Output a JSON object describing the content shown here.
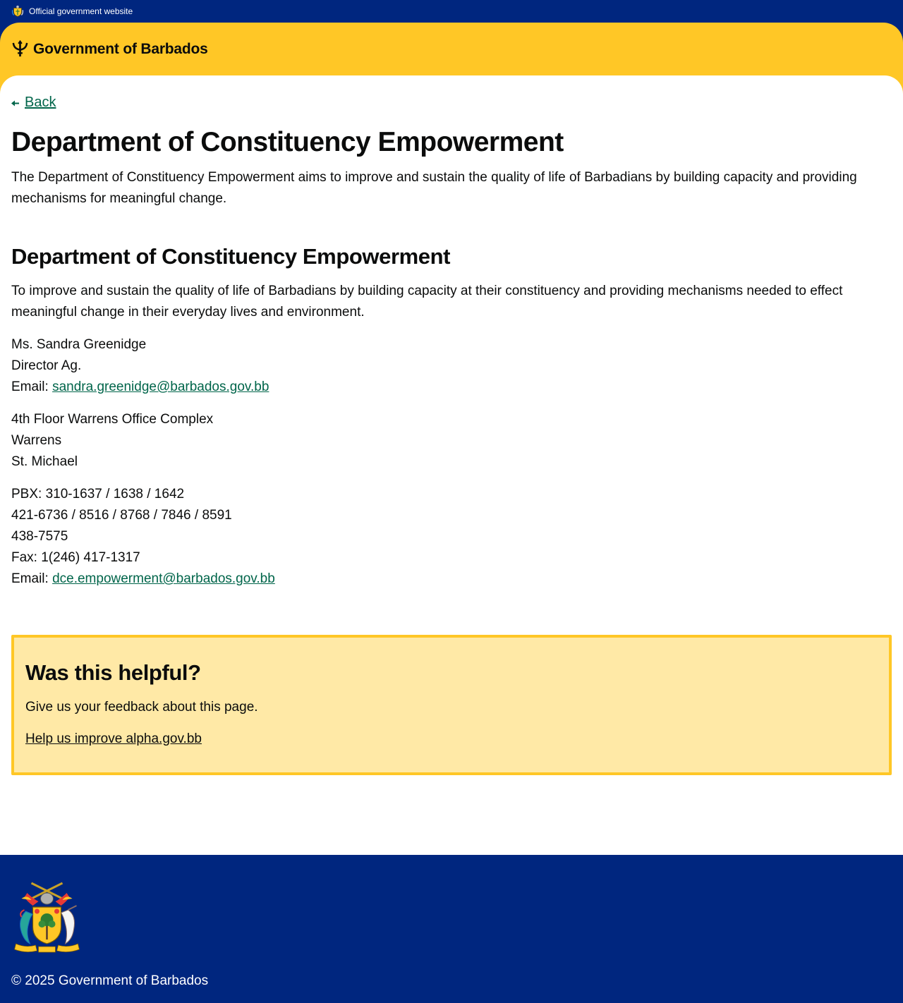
{
  "topbar": {
    "official_text": "Official government website",
    "crest_icon": "coat-of-arms-icon"
  },
  "header": {
    "brand": "Government of Barbados",
    "logo_icon": "trident-icon",
    "background_color": "#ffc726"
  },
  "nav": {
    "back_label": "Back"
  },
  "main": {
    "title": "Department of Constituency Empowerment",
    "lead": "The Department of Constituency Empowerment aims to improve and sustain the quality of life of Barbadians by building capacity and providing mechanisms for meaningful change.",
    "section_title": "Department of Constituency Empowerment",
    "section_text": "To improve and sustain the quality of life of Barbadians by building capacity at their constituency and providing mechanisms needed to effect meaningful change in their everyday lives and environment.",
    "director": {
      "name": "Ms. Sandra Greenidge",
      "role": "Director Ag.",
      "email_label": "Email: ",
      "email": "sandra.greenidge@barbados.gov.bb"
    },
    "address": {
      "line1": "4th Floor Warrens Office Complex",
      "line2": "Warrens",
      "line3": "St. Michael"
    },
    "contact": {
      "pbx": "PBX: 310-1637 / 1638 / 1642",
      "phones": "421-6736 / 8516 / 8768 / 7846 / 8591",
      "phone2": "438-7575",
      "fax": "Fax: 1(246) 417-1317",
      "email_label": "Email: ",
      "email": "dce.empowerment@barbados.gov.bb"
    }
  },
  "feedback": {
    "title": "Was this helpful?",
    "text": "Give us your feedback about this page.",
    "link": "Help us improve alpha.gov.bb"
  },
  "footer": {
    "crest_icon": "coat-of-arms-icon",
    "copyright": "© 2025 Government of Barbados"
  },
  "colors": {
    "navy": "#00267f",
    "gold": "#ffc726",
    "link_green": "#00654a",
    "feedback_bg": "#ffe9a6"
  }
}
